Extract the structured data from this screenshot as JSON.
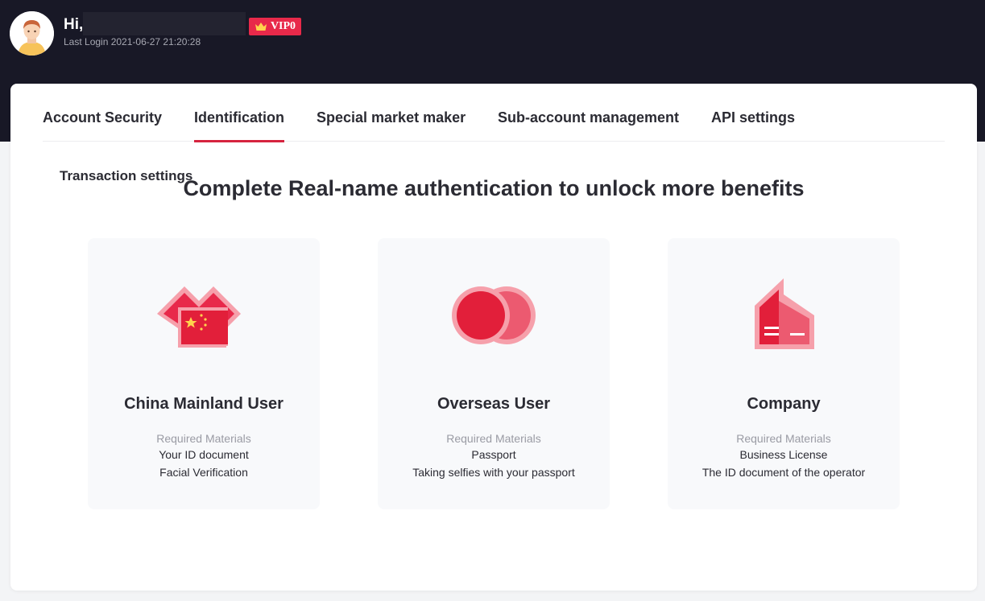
{
  "header": {
    "greeting": "Hi,",
    "vip_badge": "VIP0",
    "last_login": "Last Login 2021-06-27 21:20:28"
  },
  "tabs": [
    {
      "label": "Account Security",
      "active": false
    },
    {
      "label": "Identification",
      "active": true
    },
    {
      "label": "Special market maker",
      "active": false
    },
    {
      "label": "Sub-account management",
      "active": false
    },
    {
      "label": "API settings",
      "active": false
    }
  ],
  "subtab": {
    "label": "Transaction settings"
  },
  "main": {
    "headline": "Complete Real-name authentication to unlock more benefits",
    "options": [
      {
        "title": "China Mainland User",
        "required_label": "Required Materials",
        "materials": [
          "Your ID document",
          "Facial Verification"
        ],
        "icon": "china-flag-icon"
      },
      {
        "title": "Overseas User",
        "required_label": "Required Materials",
        "materials": [
          "Passport",
          "Taking selfies with your passport"
        ],
        "icon": "overlapping-circles-icon"
      },
      {
        "title": "Company",
        "required_label": "Required Materials",
        "materials": [
          "Business License",
          "The ID document of the operator"
        ],
        "icon": "building-icon"
      }
    ]
  },
  "colors": {
    "accent": "#d6243f",
    "header_bg": "#181826",
    "icon_red": "#e8294a",
    "icon_pink": "#f6a0ab"
  }
}
